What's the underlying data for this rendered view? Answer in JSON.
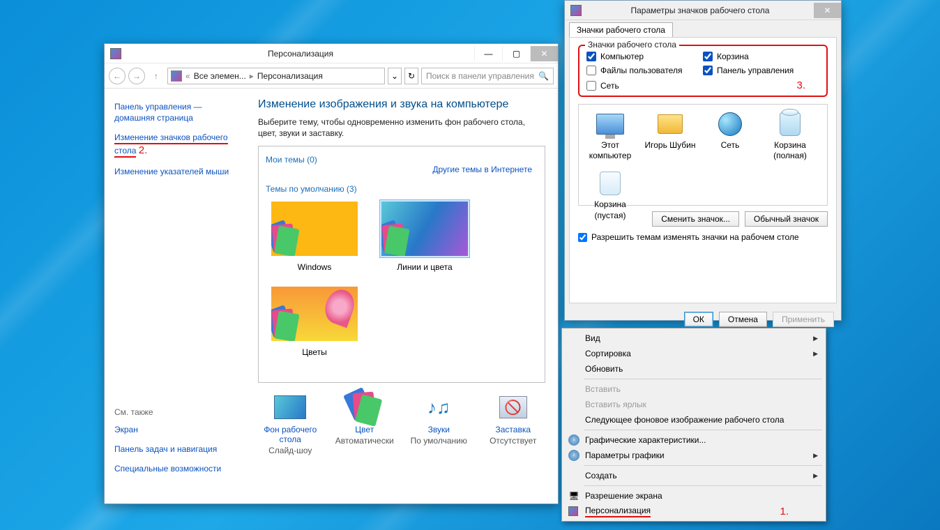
{
  "mainWin": {
    "title": "Персонализация",
    "breadcrumb": {
      "first": "Все элемен...",
      "second": "Персонализация",
      "sep": "«"
    },
    "searchPlaceholder": "Поиск в панели управления",
    "sidebar": {
      "home": "Панель управления — домашняя страница",
      "changeIcons": "Изменение значков рабочего стола",
      "changePointers": "Изменение указателей мыши",
      "seeAlso": "См. также",
      "screen": "Экран",
      "taskbar": "Панель задач и навигация",
      "ease": "Специальные возможности"
    },
    "heading": "Изменение изображения и звука на компьютере",
    "subtext": "Выберите тему, чтобы одновременно изменить фон рабочего стола, цвет, звуки и заставку.",
    "myThemes": "Мои темы (0)",
    "onlineThemes": "Другие темы в Интернете",
    "defaultThemes": "Темы по умолчанию (3)",
    "themes": [
      {
        "name": "Windows"
      },
      {
        "name": "Линии и цвета"
      },
      {
        "name": "Цветы"
      }
    ],
    "options": [
      {
        "label": "Фон рабочего стола",
        "value": "Слайд-шоу"
      },
      {
        "label": "Цвет",
        "value": "Автоматически"
      },
      {
        "label": "Звуки",
        "value": "По умолчанию"
      },
      {
        "label": "Заставка",
        "value": "Отсутствует"
      }
    ]
  },
  "dlg": {
    "title": "Параметры значков рабочего стола",
    "tab": "Значки рабочего стола",
    "groupLegend": "Значки рабочего стола",
    "checks": {
      "computer": "Компьютер",
      "recycle": "Корзина",
      "userfiles": "Файлы пользователя",
      "cpanel": "Панель управления",
      "network": "Сеть"
    },
    "icons": [
      {
        "label": "Этот компьютер"
      },
      {
        "label": "Игорь Шубин"
      },
      {
        "label": "Сеть"
      },
      {
        "label": "Корзина (полная)"
      },
      {
        "label": "Корзина (пустая)"
      }
    ],
    "changeIconBtn": "Сменить значок...",
    "defaultIconBtn": "Обычный значок",
    "allowThemes": "Разрешить темам изменять значки на рабочем столе",
    "ok": "ОК",
    "cancel": "Отмена",
    "apply": "Применить"
  },
  "ctx": {
    "view": "Вид",
    "sort": "Сортировка",
    "refresh": "Обновить",
    "paste": "Вставить",
    "pasteShortcut": "Вставить ярлык",
    "nextBg": "Следующее фоновое изображение рабочего стола",
    "gfx": "Графические характеристики...",
    "gfxParams": "Параметры графики",
    "create": "Создать",
    "resolution": "Разрешение экрана",
    "personalize": "Персонализация"
  },
  "annot": {
    "n1": "1.",
    "n2": "2.",
    "n3": "3."
  }
}
